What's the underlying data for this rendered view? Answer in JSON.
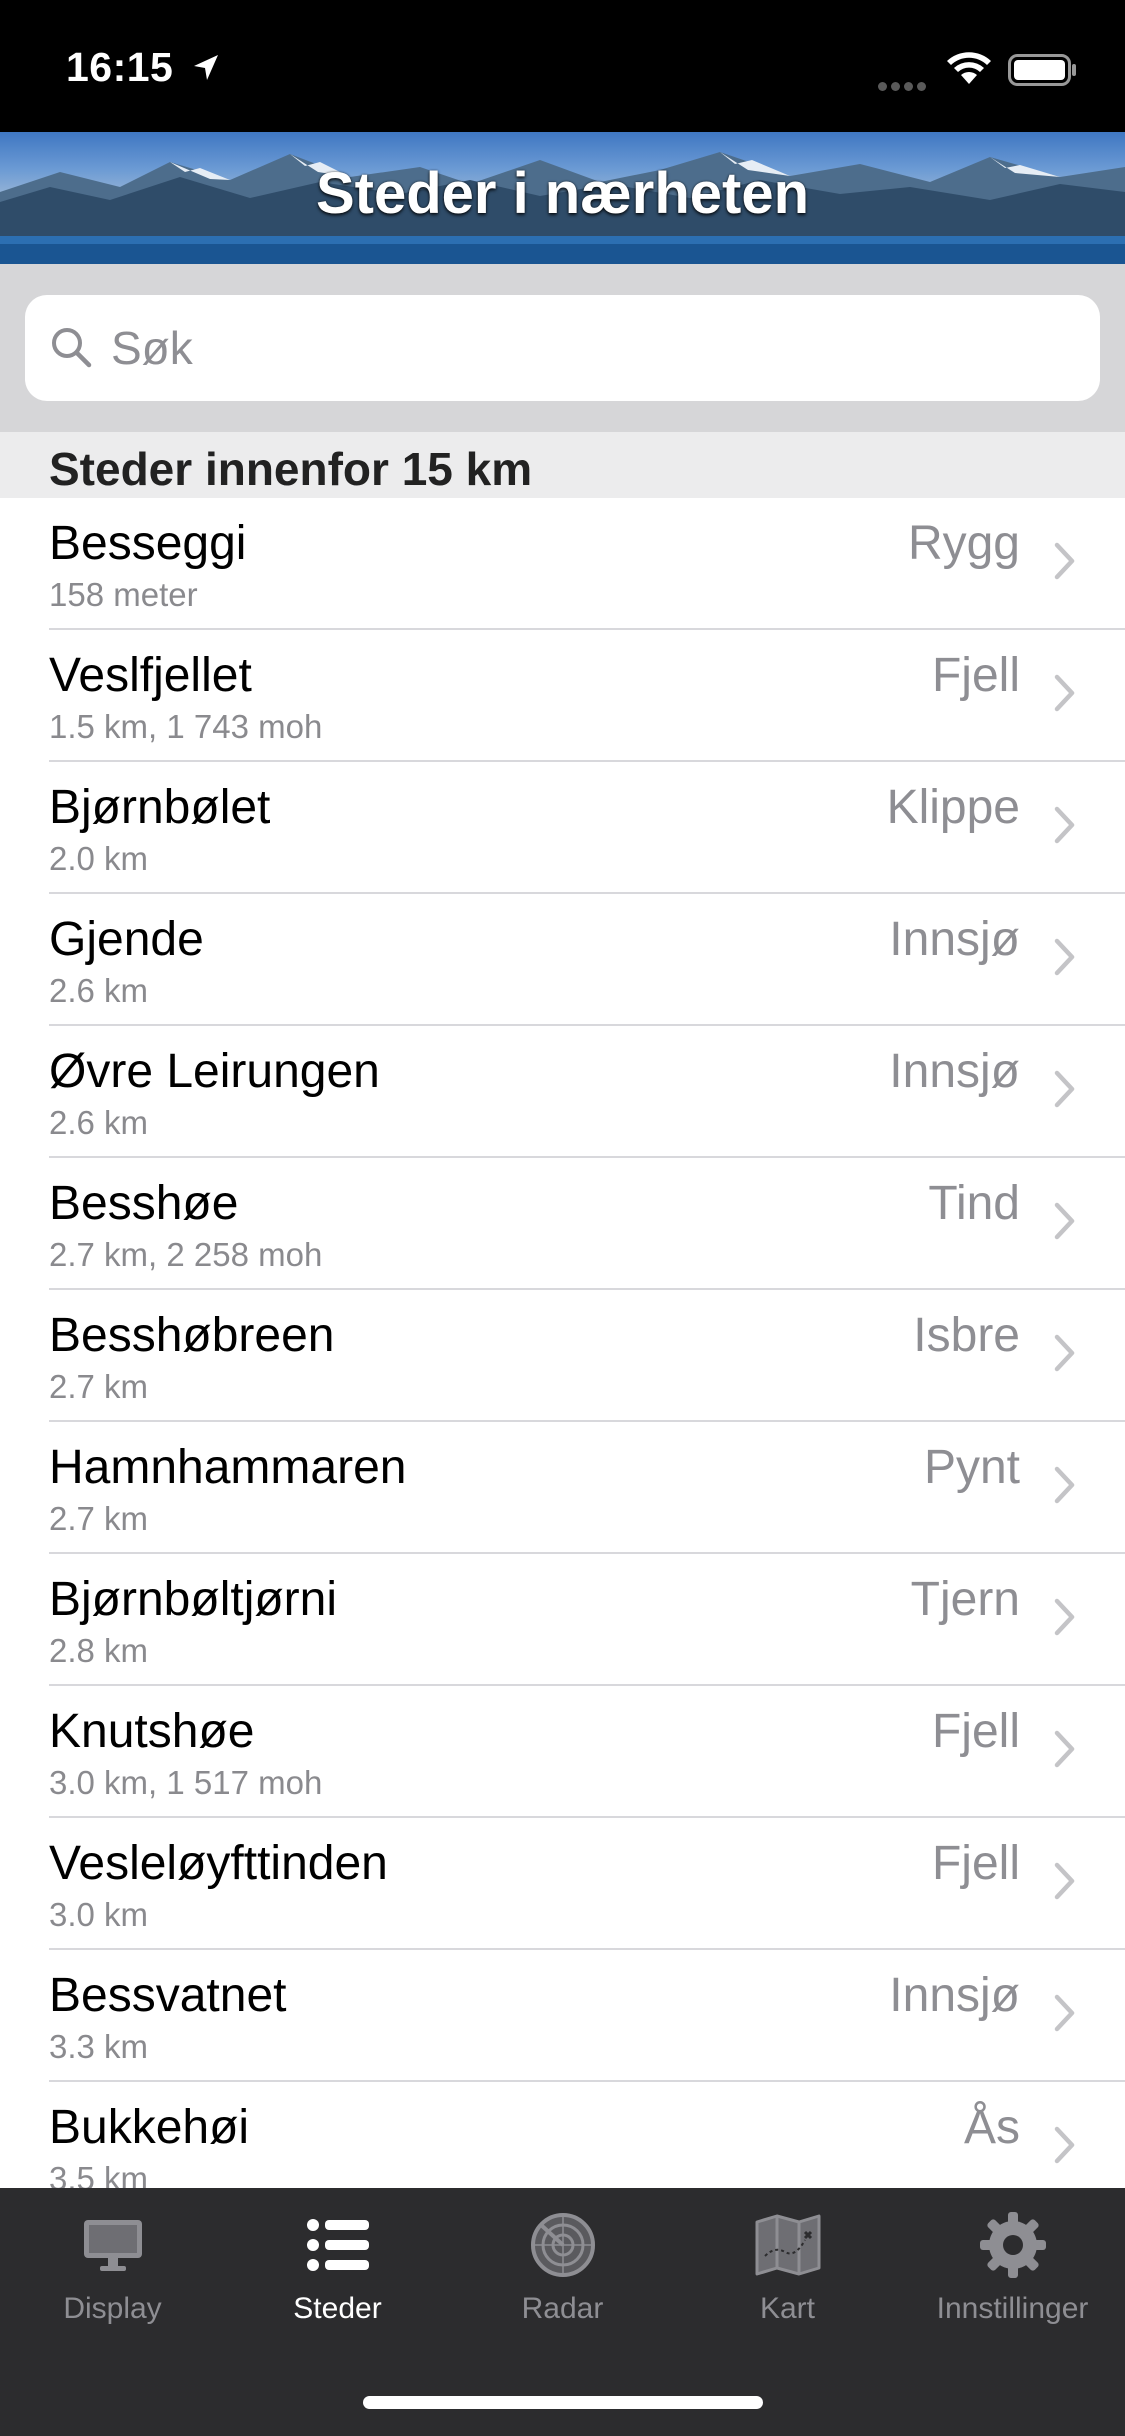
{
  "status_bar": {
    "time": "16:15"
  },
  "header": {
    "title": "Steder i nærheten"
  },
  "search": {
    "placeholder": "Søk"
  },
  "section": {
    "title": "Steder innenfor 15 km"
  },
  "places": [
    {
      "name": "Besseggi",
      "detail": "158 meter",
      "type": "Rygg"
    },
    {
      "name": "Veslfjellet",
      "detail": "1.5 km, 1 743 moh",
      "type": "Fjell"
    },
    {
      "name": "Bjørnbølet",
      "detail": "2.0 km",
      "type": "Klippe"
    },
    {
      "name": "Gjende",
      "detail": "2.6 km",
      "type": "Innsjø"
    },
    {
      "name": "Øvre Leirungen",
      "detail": "2.6 km",
      "type": "Innsjø"
    },
    {
      "name": "Besshøe",
      "detail": "2.7 km, 2 258 moh",
      "type": "Tind"
    },
    {
      "name": "Besshøbreen",
      "detail": "2.7 km",
      "type": "Isbre"
    },
    {
      "name": "Hamnhammaren",
      "detail": "2.7 km",
      "type": "Pynt"
    },
    {
      "name": "Bjørnbøltjørni",
      "detail": "2.8 km",
      "type": "Tjern"
    },
    {
      "name": "Knutshøe",
      "detail": "3.0 km, 1 517 moh",
      "type": "Fjell"
    },
    {
      "name": "Vesleløyfttinden",
      "detail": "3.0 km",
      "type": "Fjell"
    },
    {
      "name": "Bessvatnet",
      "detail": "3.3 km",
      "type": "Innsjø"
    },
    {
      "name": "Bukkehøi",
      "detail": "3.5 km",
      "type": "Ås"
    }
  ],
  "tabs": [
    {
      "label": "Display",
      "icon": "display-icon",
      "active": false
    },
    {
      "label": "Steder",
      "icon": "list-icon",
      "active": true
    },
    {
      "label": "Radar",
      "icon": "radar-icon",
      "active": false
    },
    {
      "label": "Kart",
      "icon": "map-icon",
      "active": false
    },
    {
      "label": "Innstillinger",
      "icon": "gear-icon",
      "active": false
    }
  ],
  "colors": {
    "tabbar_bg": "#2c2c2e",
    "tab_inactive": "#8e8e93",
    "tab_active": "#ffffff",
    "secondary_text": "#8e8e93"
  }
}
